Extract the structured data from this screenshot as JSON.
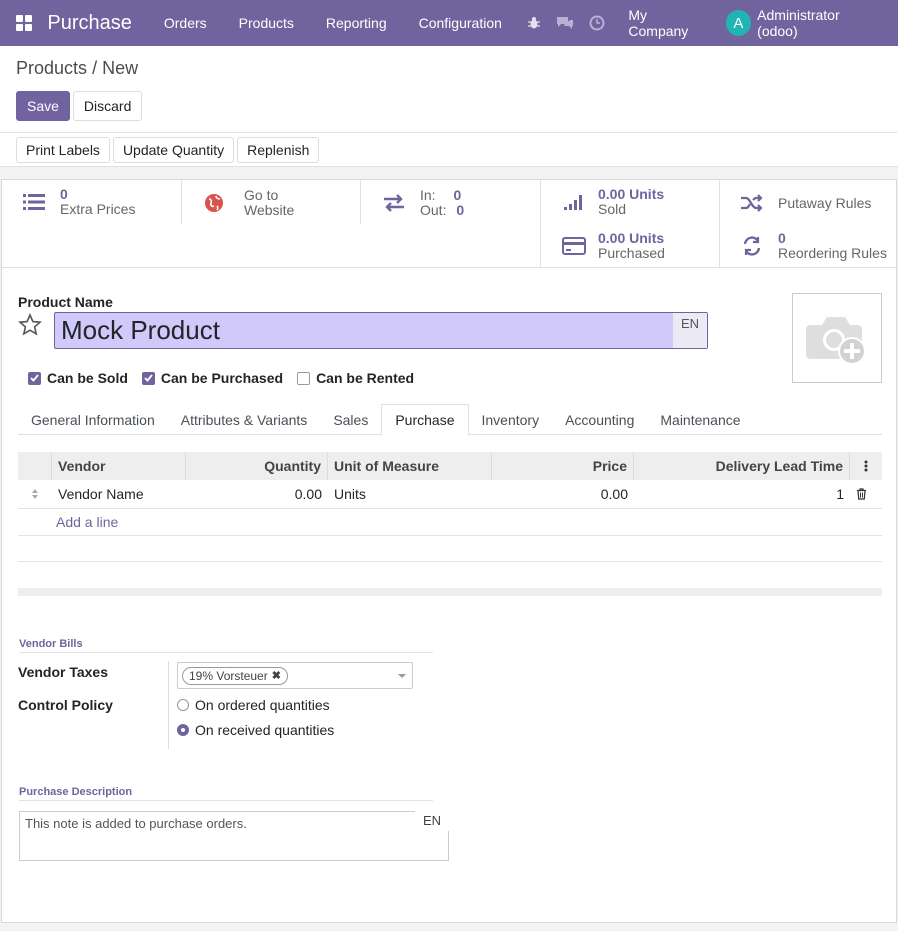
{
  "navbar": {
    "app_name": "Purchase",
    "menu": [
      "Orders",
      "Products",
      "Reporting",
      "Configuration"
    ],
    "company": "My Company",
    "avatar_letter": "A",
    "user": "Administrator (odoo)",
    "bg_color": "#71639e"
  },
  "breadcrumb": {
    "parent": "Products",
    "separator": "/",
    "current": "New"
  },
  "buttons": {
    "save": "Save",
    "discard": "Discard"
  },
  "actions": [
    "Print Labels",
    "Update Quantity",
    "Replenish"
  ],
  "stats": {
    "extra_prices": {
      "value": "0",
      "label": "Extra Prices"
    },
    "website": {
      "line1": "Go to",
      "line2": "Website"
    },
    "in_out": {
      "in_label": "In:",
      "in_value": "0",
      "out_label": "Out:",
      "out_value": "0"
    },
    "sold": {
      "value": "0.00 Units",
      "label": "Sold"
    },
    "purchased": {
      "value": "0.00 Units",
      "label": "Purchased"
    },
    "putaway": {
      "label": "Putaway Rules"
    },
    "reordering": {
      "value": "0",
      "label": "Reordering Rules"
    }
  },
  "form": {
    "product_name_label": "Product Name",
    "product_name": "Mock Product",
    "lang": "EN",
    "checks": [
      {
        "label": "Can be Sold",
        "checked": true
      },
      {
        "label": "Can be Purchased",
        "checked": true
      },
      {
        "label": "Can be Rented",
        "checked": false
      }
    ]
  },
  "tabs": [
    "General Information",
    "Attributes & Variants",
    "Sales",
    "Purchase",
    "Inventory",
    "Accounting",
    "Maintenance"
  ],
  "active_tab": "Purchase",
  "vendor_table": {
    "columns": [
      "Vendor",
      "Quantity",
      "Unit of Measure",
      "Price",
      "Delivery Lead Time"
    ],
    "rows": [
      {
        "vendor": "Vendor Name",
        "quantity": "0.00",
        "uom": "Units",
        "price": "0.00",
        "lead_time": "1"
      }
    ],
    "add_line": "Add a line"
  },
  "vendor_bills": {
    "title": "Vendor Bills",
    "taxes_label": "Vendor Taxes",
    "tax_tag": "19% Vorsteuer",
    "control_label": "Control Policy",
    "control_options": [
      {
        "label": "On ordered quantities",
        "selected": false
      },
      {
        "label": "On received quantities",
        "selected": true
      }
    ]
  },
  "purchase_description": {
    "title": "Purchase Description",
    "placeholder": "This note is added to purchase orders.",
    "lang": "EN"
  }
}
